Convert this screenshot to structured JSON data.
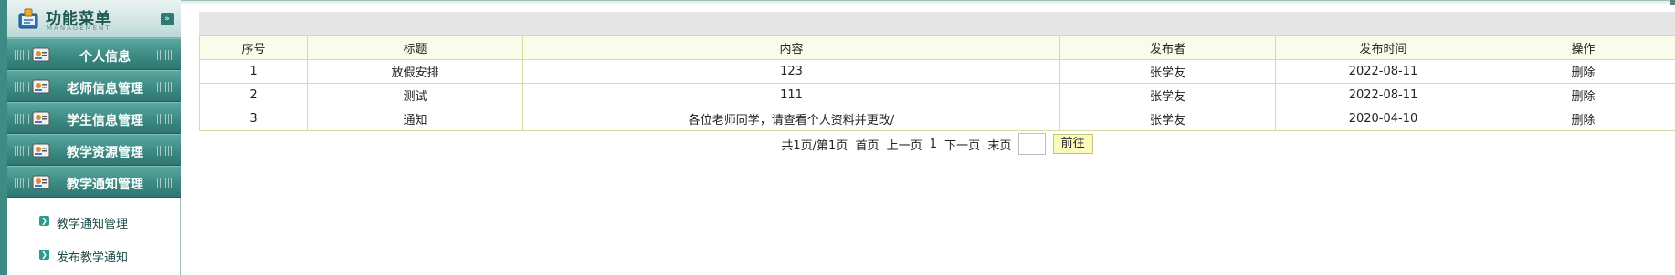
{
  "sidebar": {
    "header": {
      "title": "功能菜单",
      "subtitle": "MANAGEMENT",
      "collapse_icon": "double-chevron-down-icon"
    },
    "items": [
      {
        "label": "个人信息",
        "icon": "user-card-icon"
      },
      {
        "label": "老师信息管理",
        "icon": "user-card-icon"
      },
      {
        "label": "学生信息管理",
        "icon": "user-card-icon"
      },
      {
        "label": "教学资源管理",
        "icon": "user-card-icon"
      },
      {
        "label": "教学通知管理",
        "icon": "user-card-icon"
      }
    ],
    "subitems": [
      {
        "label": "教学通知管理",
        "icon": "arrow-right-icon"
      },
      {
        "label": "发布教学通知",
        "icon": "arrow-right-icon"
      }
    ]
  },
  "table": {
    "headers": [
      "序号",
      "标题",
      "内容",
      "发布者",
      "发布时间",
      "操作"
    ],
    "rows": [
      {
        "no": "1",
        "title": "放假安排",
        "content": "123",
        "publisher": "张学友",
        "time": "2022-08-11",
        "action": "删除"
      },
      {
        "no": "2",
        "title": "测试",
        "content": "111",
        "publisher": "张学友",
        "time": "2022-08-11",
        "action": "删除"
      },
      {
        "no": "3",
        "title": "通知",
        "content": "各位老师同学，请查看个人资料并更改/",
        "publisher": "张学友",
        "time": "2020-04-10",
        "action": "删除"
      }
    ]
  },
  "pager": {
    "summary": "共1页/第1页",
    "first": "首页",
    "prev": "上一页",
    "current": "1",
    "next": "下一页",
    "last": "末页",
    "input_value": "",
    "go_label": "前往"
  },
  "colors": {
    "sidebar_teal": "#3c8a83",
    "table_border": "#d6dca8",
    "header_bg": "#fbfbe9",
    "go_button": "#fafabf"
  }
}
